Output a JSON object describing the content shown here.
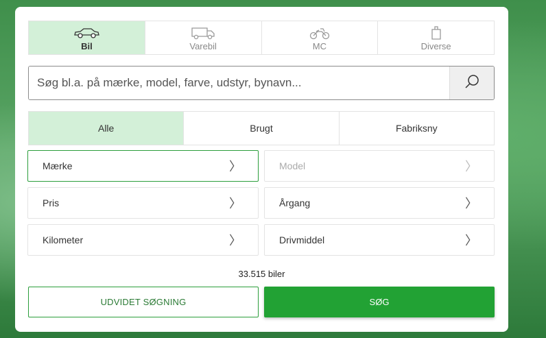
{
  "vehicle_types": [
    {
      "label": "Bil",
      "icon": "car-icon",
      "active": true
    },
    {
      "label": "Varebil",
      "icon": "van-icon",
      "active": false
    },
    {
      "label": "MC",
      "icon": "motorcycle-icon",
      "active": false
    },
    {
      "label": "Diverse",
      "icon": "misc-icon",
      "active": false
    }
  ],
  "search": {
    "placeholder": "Søg bl.a. på mærke, model, farve, udstyr, bynavn...",
    "value": "",
    "button_icon": "search-icon"
  },
  "conditions": [
    {
      "label": "Alle",
      "active": true
    },
    {
      "label": "Brugt",
      "active": false
    },
    {
      "label": "Fabriksny",
      "active": false
    }
  ],
  "filters": [
    {
      "label": "Mærke",
      "state": "focused"
    },
    {
      "label": "Model",
      "state": "disabled"
    },
    {
      "label": "Pris",
      "state": "normal"
    },
    {
      "label": "Årgang",
      "state": "normal"
    },
    {
      "label": "Kilometer",
      "state": "normal"
    },
    {
      "label": "Drivmiddel",
      "state": "normal"
    }
  ],
  "result_count": "33.515 biler",
  "buttons": {
    "advanced": "UDVIDET SØGNING",
    "search": "SØG"
  },
  "colors": {
    "accent": "#22a234",
    "active_bg": "#d3f0d8"
  }
}
